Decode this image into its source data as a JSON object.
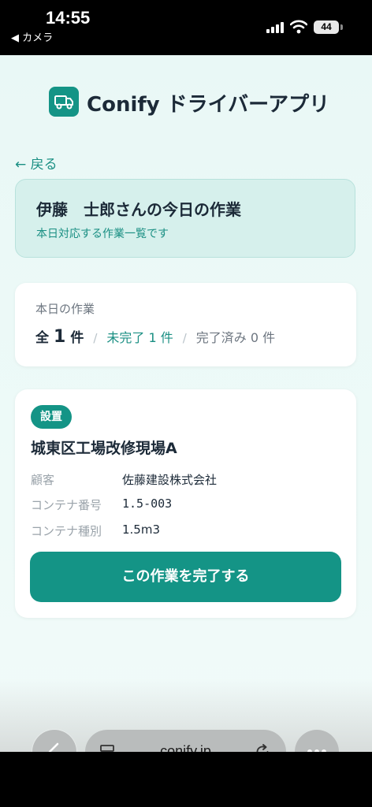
{
  "status_bar": {
    "time": "14:55",
    "back_app": "◀ カメラ",
    "battery": "44"
  },
  "header": {
    "app_title": "Conify ドライバーアプリ",
    "logo_icon": "truck-icon",
    "accent_color": "#149486"
  },
  "nav": {
    "back_label": "← 戻る"
  },
  "welcome": {
    "title": "伊藤　士郎さんの今日の作業",
    "subtitle": "本日対応する作業一覧です"
  },
  "summary": {
    "label": "本日の作業",
    "total_prefix": "全",
    "total_count": "1",
    "total_unit": "件",
    "separator": "/",
    "pending": "未完了 1 件",
    "done": "完了済み 0 件"
  },
  "job": {
    "badge": "設置",
    "title": "城東区工場改修現場A",
    "details": [
      {
        "label": "顧客",
        "value": "佐藤建設株式会社"
      },
      {
        "label": "コンテナ番号",
        "value": "1.5-003"
      },
      {
        "label": "コンテナ種別",
        "value": "1.5m3"
      }
    ],
    "complete_button": "この作業を完了する"
  },
  "browser": {
    "url": "conify.jp"
  }
}
